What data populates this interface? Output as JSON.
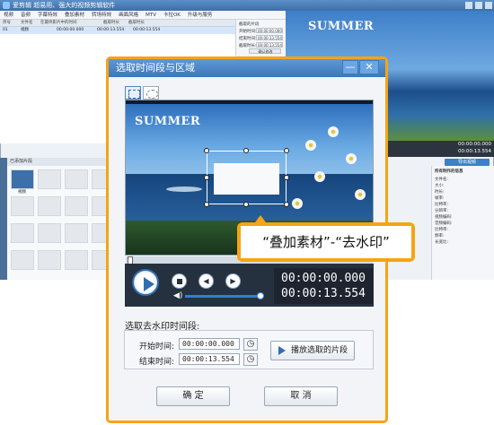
{
  "app": {
    "title": "爱剪辑   超易用、强大的视频剪辑软件",
    "menu": [
      "视频",
      "音频",
      "字幕特效",
      "叠加素材",
      "转场特效",
      "画面风格",
      "MTV",
      "卡拉OK",
      "升级与服务"
    ],
    "list_columns": [
      "序号",
      "文件名",
      "在最终影片中的时间",
      "截取时长",
      "截取时长"
    ],
    "list_row": [
      "01",
      "视频",
      "00:00:00.000",
      "00:00:13.554",
      "00:00:13.554"
    ],
    "clip_panel": {
      "heading": "截取的片段",
      "start_label": "开始时间:",
      "start_value": "00:00:00.000",
      "end_label": "结束时间:",
      "end_value": "00:00:13.554",
      "duration_label": "截取时长:",
      "duration_value": "00:00:13.554",
      "confirm_label": "确认修改"
    },
    "preview_summer": "SUMMER",
    "timebar": [
      "00:00:00.000",
      "00:00:13.554"
    ],
    "bottom_tab": "已添加片段",
    "media_label": "视频",
    "export_label": "导出视频",
    "props": [
      "所有制作的信息",
      "文件名:",
      "大小:",
      "时长:",
      "帧率:",
      "比特率:",
      "分辨率:",
      "视频编码:",
      "音频编码:",
      "比特率:",
      "频率:",
      "长宽比:"
    ]
  },
  "dialog": {
    "title": "选取时间段与区域",
    "minimize_icon": "—",
    "close_icon": "✕",
    "preview_text": "SUMMER",
    "callout": "“叠加素材”-“去水印”",
    "time_current": "00:00:00.000",
    "time_total": "00:00:13.554",
    "section_title": "选取去水印时间段:",
    "start_label": "开始时间:",
    "start_value": "00:00:00.000",
    "end_label": "结束时间:",
    "end_value": "00:00:13.554",
    "play_selection_label": "播放选取的片段",
    "ok_label": "确 定",
    "cancel_label": "取 消",
    "accent_color": "#f6a414"
  }
}
